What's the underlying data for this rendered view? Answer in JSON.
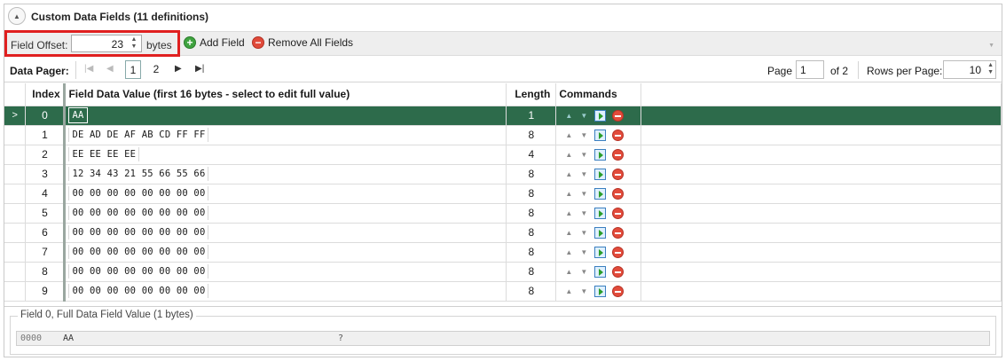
{
  "header": {
    "title": "Custom Data Fields (11 definitions)",
    "collapse_glyph": "▲"
  },
  "toolbar": {
    "offset_label": "Field Offset:",
    "offset_value": "23",
    "offset_unit": "bytes",
    "add_label": "Add Field",
    "remove_label": "Remove All Fields"
  },
  "pager": {
    "label": "Data Pager:",
    "pages": [
      "1",
      "2"
    ],
    "current_page": "1",
    "page_label": "Page",
    "page_input": "1",
    "of_label": "of 2",
    "rows_label": "Rows per Page:",
    "rows_value": "10"
  },
  "grid": {
    "columns": [
      "Index",
      "Field Data Value (first 16 bytes - select to edit full value)",
      "Length",
      "Commands"
    ],
    "rows": [
      {
        "index": "0",
        "value": "AA",
        "length": "1"
      },
      {
        "index": "1",
        "value": "DE AD DE AF AB CD FF FF",
        "length": "8"
      },
      {
        "index": "2",
        "value": "EE EE EE EE",
        "length": "4"
      },
      {
        "index": "3",
        "value": "12 34 43 21 55 66 55 66",
        "length": "8"
      },
      {
        "index": "4",
        "value": "00 00 00 00 00 00 00 00",
        "length": "8"
      },
      {
        "index": "5",
        "value": "00 00 00 00 00 00 00 00",
        "length": "8"
      },
      {
        "index": "6",
        "value": "00 00 00 00 00 00 00 00",
        "length": "8"
      },
      {
        "index": "7",
        "value": "00 00 00 00 00 00 00 00",
        "length": "8"
      },
      {
        "index": "8",
        "value": "00 00 00 00 00 00 00 00",
        "length": "8"
      },
      {
        "index": "9",
        "value": "00 00 00 00 00 00 00 00",
        "length": "8"
      }
    ],
    "selected_index": 0,
    "selected_marker": ">"
  },
  "footer": {
    "group_title": "Field 0, Full Data Field Value (1 bytes)",
    "offset": "0000",
    "hex": "AA",
    "ascii": "?"
  },
  "colors": {
    "selected_row": "#2d6b4b",
    "highlight_box": "#e02020",
    "add_icon": "#3fa33f",
    "remove_icon": "#e04a3a"
  }
}
